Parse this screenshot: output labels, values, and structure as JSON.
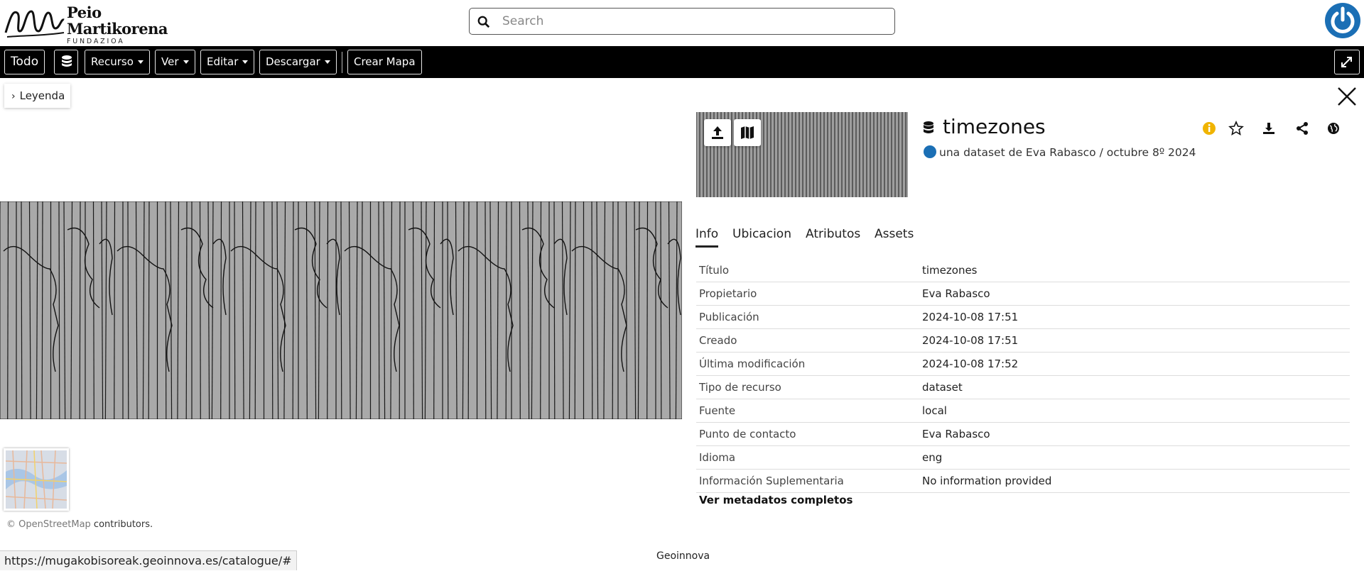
{
  "logo": {
    "line1": "Peio",
    "line2": "Martikorena",
    "line3": "FUNDAZIOA"
  },
  "search": {
    "placeholder": "Search",
    "icon": "search-icon"
  },
  "toolbar": {
    "todo": "Todo",
    "recurso": "Recurso",
    "ver": "Ver",
    "editar": "Editar",
    "descargar": "Descargar",
    "crear_mapa": "Crear Mapa"
  },
  "map": {
    "legend_label": "Leyenda",
    "attribution_osm": "© OpenStreetMap",
    "attribution_rest": " contributors."
  },
  "resource": {
    "title": "timezones",
    "subtitle": "una dataset de Eva Rabasco / octubre 8º 2024",
    "accent_color": "#f0b400"
  },
  "tabs": [
    {
      "label": "Info"
    },
    {
      "label": "Ubicacion"
    },
    {
      "label": "Atributos"
    },
    {
      "label": "Assets"
    }
  ],
  "info_rows": [
    {
      "key": "Título",
      "value": "timezones"
    },
    {
      "key": "Propietario",
      "value": "Eva Rabasco"
    },
    {
      "key": "Publicación",
      "value": "2024-10-08 17:51"
    },
    {
      "key": "Creado",
      "value": "2024-10-08 17:51"
    },
    {
      "key": "Última modificación",
      "value": "2024-10-08 17:52"
    },
    {
      "key": "Tipo de recurso",
      "value": "dataset"
    },
    {
      "key": "Fuente",
      "value": "local"
    },
    {
      "key": "Punto de contacto",
      "value": "Eva Rabasco"
    },
    {
      "key": "Idioma",
      "value": "eng"
    },
    {
      "key": "Información Suplementaria",
      "value": "No information provided"
    }
  ],
  "meta_link": "Ver metadatos completos",
  "status_url": "https://mugakobisoreak.geoinnova.es/catalogue/#",
  "footer": "Geoinnova"
}
